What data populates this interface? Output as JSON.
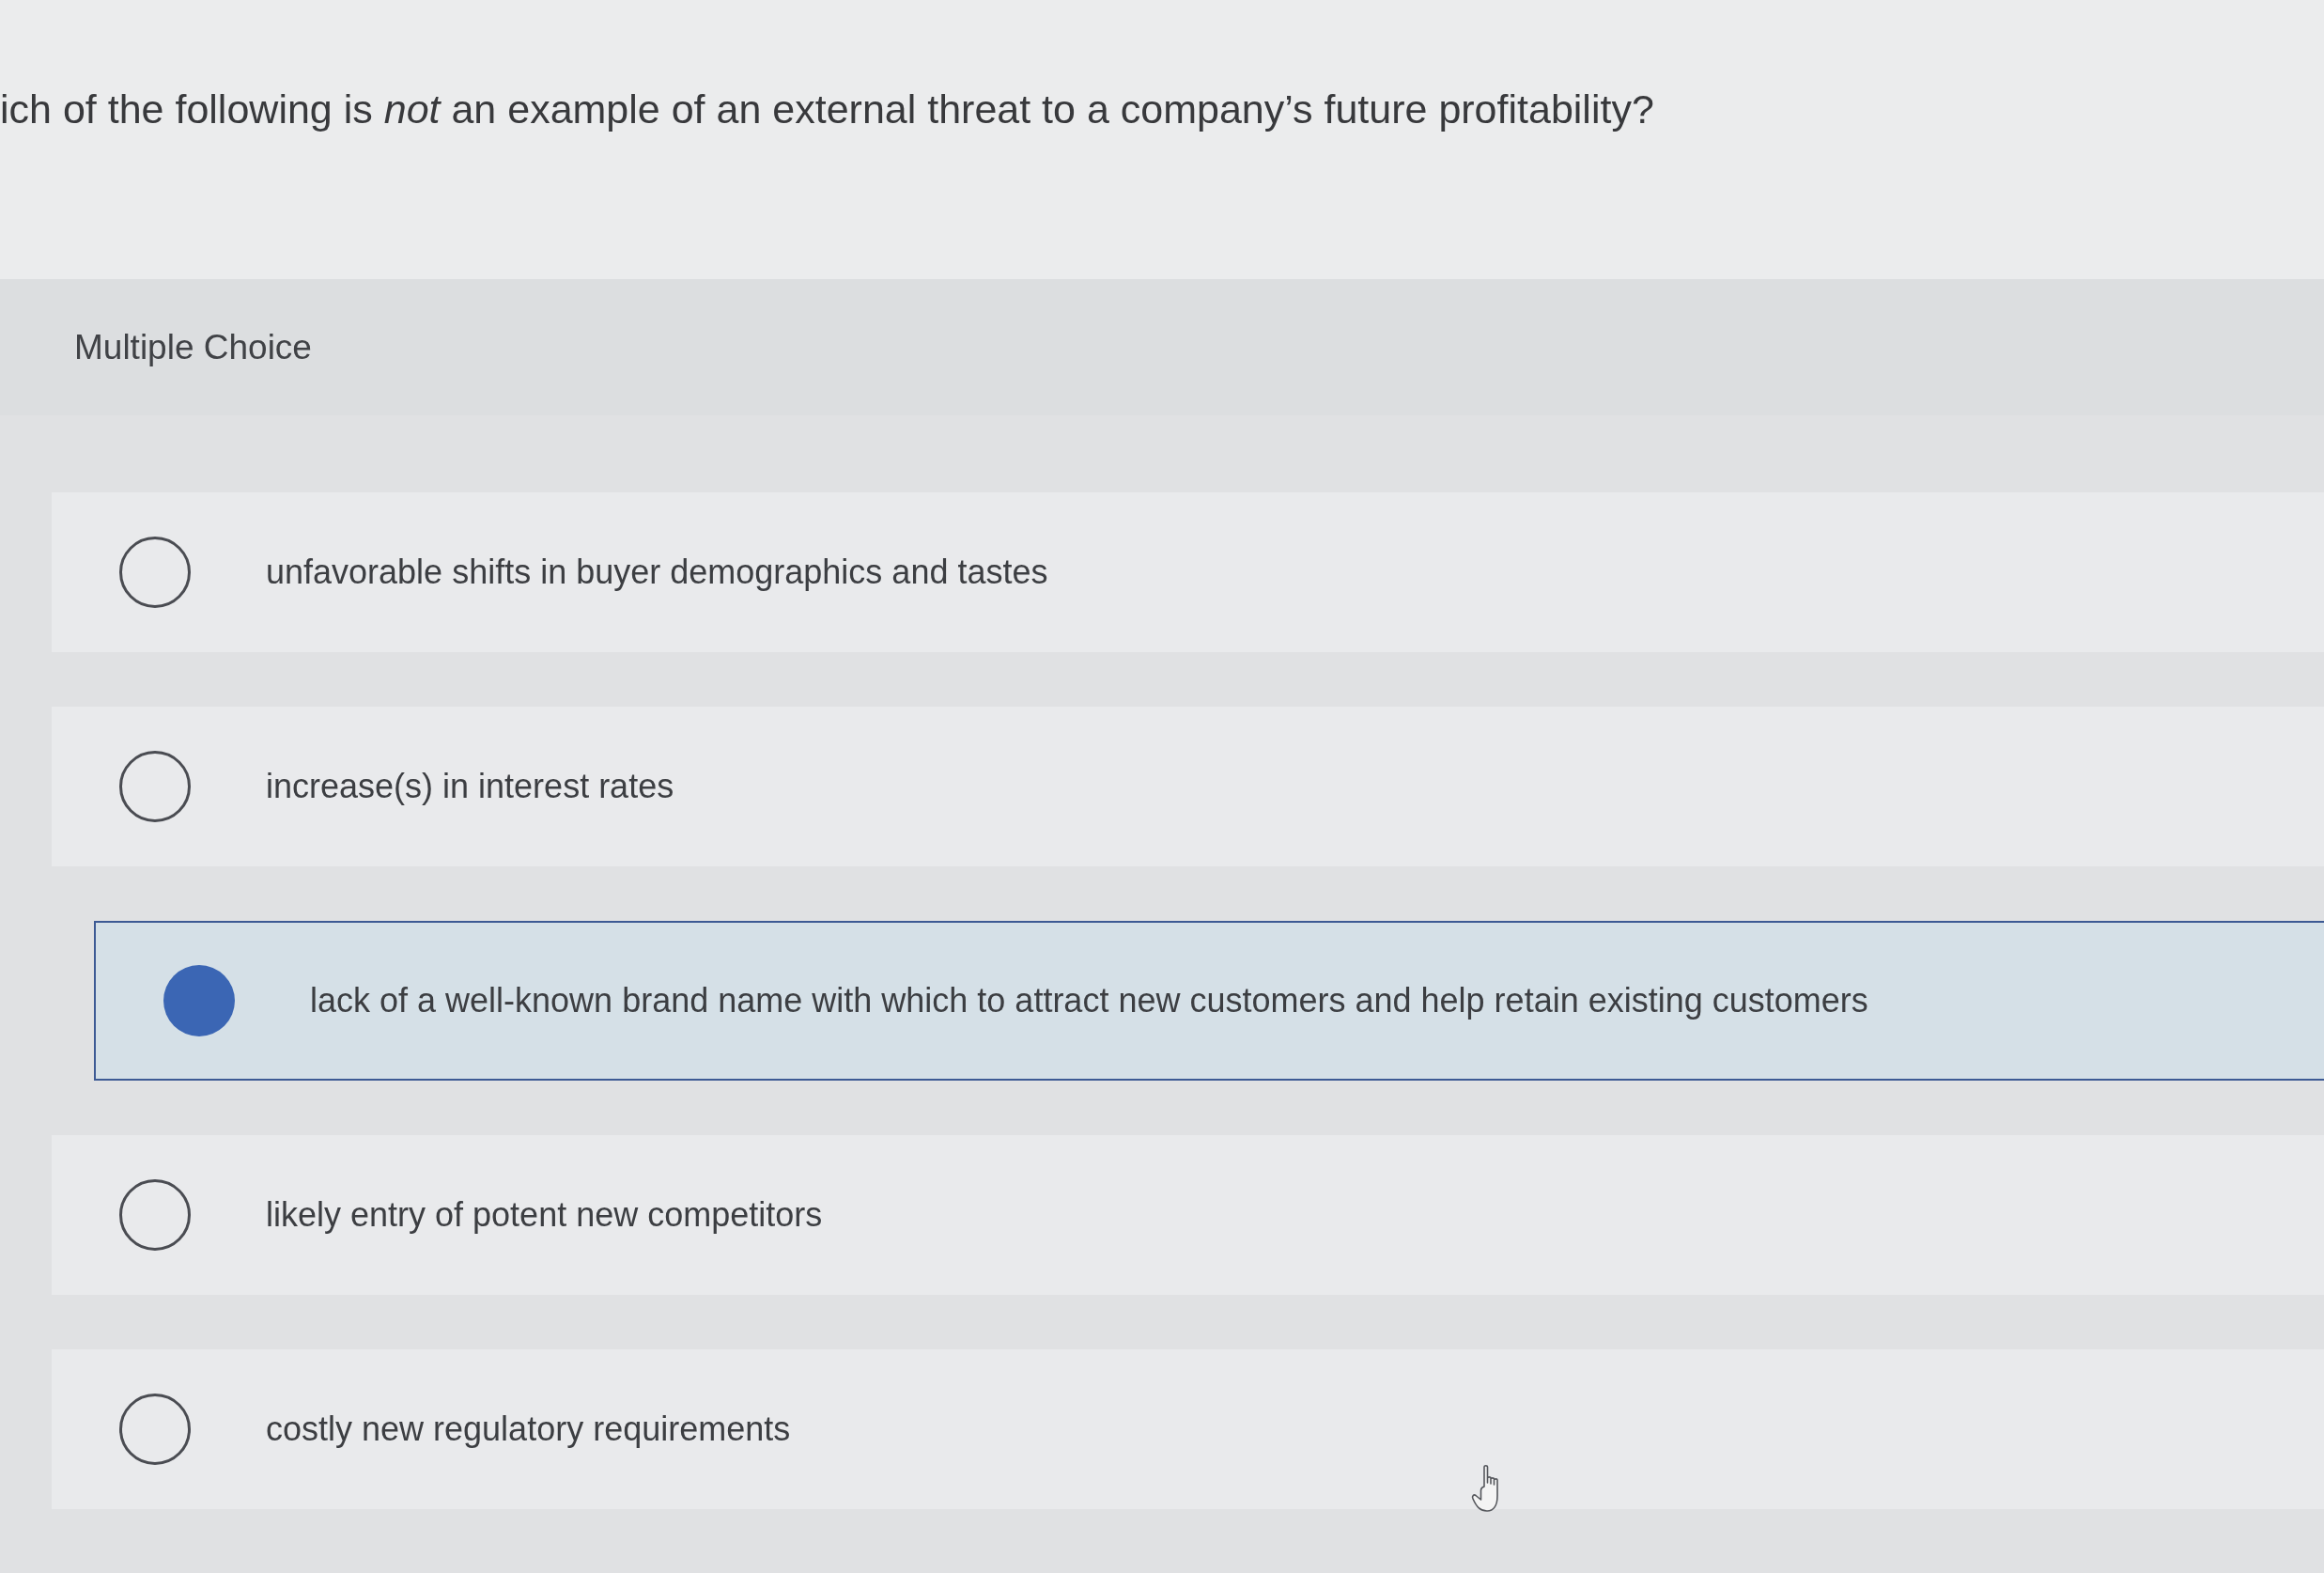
{
  "question": {
    "text": "ich of the following is *not* an example of an external threat to a company’s future profitability?"
  },
  "answer_area": {
    "heading": "Multiple Choice",
    "options": [
      {
        "label": "unfavorable shifts in buyer demographics and tastes",
        "selected": false
      },
      {
        "label": "increase(s) in interest rates",
        "selected": false
      },
      {
        "label": "lack of a well-known brand name with which to attract new customers and help retain existing customers",
        "selected": true
      },
      {
        "label": "likely entry of potent new competitors",
        "selected": false
      },
      {
        "label": "costly new regulatory requirements",
        "selected": false
      }
    ]
  }
}
